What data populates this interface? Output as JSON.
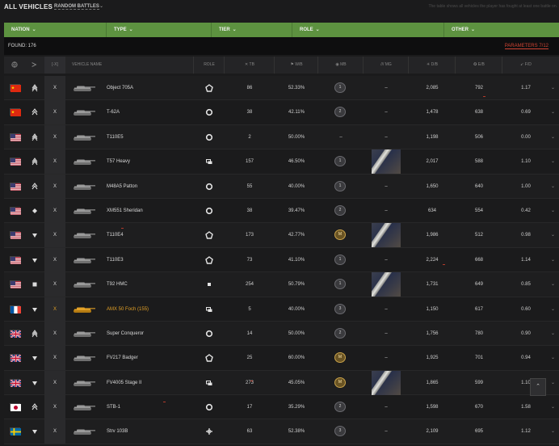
{
  "header": {
    "title": "ALL VEHICLES",
    "battle_mode": "RANDOM BATTLES",
    "note": "The table shows all vehicles the player has fought at least one battle on."
  },
  "filters": [
    {
      "label": "NATION"
    },
    {
      "label": "TYPE"
    },
    {
      "label": "TIER"
    },
    {
      "label": "ROLE"
    },
    {
      "label": "OTHER"
    }
  ],
  "found_label": "FOUND: 176",
  "parameters_label": "PARAMETERS 7/12",
  "columns": {
    "tier": "[-X]",
    "vehicle_name": "VEHICLE NAME",
    "role": "ROLE",
    "battles": "TB",
    "winrate": "W/B",
    "mastery": "MB",
    "marks": "MG",
    "damage": "D/B",
    "exp": "E/B",
    "frags": "F/D"
  },
  "colors": {
    "accent_green": "#5d9240",
    "params_red": "#cf4433",
    "highlight_orange": "#e3a126"
  },
  "rows": [
    {
      "flag": "china",
      "type_icon": "heavy-tank-icon",
      "tier": "X",
      "name": "Object 705A",
      "role_icon": "role-break-through-icon",
      "battles": "86",
      "winrate": "52.33%",
      "mastery": "1",
      "mastery_gold": false,
      "marks": "–",
      "has_marks": false,
      "dmg": "2,085",
      "exp": "792",
      "frags": "1.17"
    },
    {
      "flag": "china",
      "type_icon": "medium-tank-icon",
      "tier": "X",
      "name": "T-62A",
      "role_icon": "role-universal-icon",
      "battles": "38",
      "winrate": "42.11%",
      "mastery": "2",
      "mastery_gold": false,
      "marks": "–",
      "has_marks": false,
      "dmg": "1,478",
      "exp": "638",
      "frags": "0.69"
    },
    {
      "flag": "usa",
      "type_icon": "heavy-tank-icon",
      "tier": "X",
      "name": "T110E5",
      "role_icon": "role-universal-icon",
      "battles": "2",
      "winrate": "50.00%",
      "mastery": "–",
      "mastery_gold": false,
      "marks": "–",
      "has_marks": false,
      "dmg": "1,198",
      "exp": "506",
      "frags": "0.00"
    },
    {
      "flag": "usa",
      "type_icon": "heavy-tank-icon",
      "tier": "X",
      "name": "T57 Heavy",
      "role_icon": "role-support-icon",
      "battles": "157",
      "winrate": "46.50%",
      "mastery": "1",
      "mastery_gold": false,
      "marks": "",
      "has_marks": true,
      "dmg": "2,017",
      "exp": "588",
      "frags": "1.10"
    },
    {
      "flag": "usa",
      "type_icon": "medium-tank-icon",
      "tier": "X",
      "name": "M48A5 Patton",
      "role_icon": "role-universal-icon",
      "battles": "55",
      "winrate": "40.00%",
      "mastery": "1",
      "mastery_gold": false,
      "marks": "–",
      "has_marks": false,
      "dmg": "1,650",
      "exp": "640",
      "frags": "1.00"
    },
    {
      "flag": "usa",
      "type_icon": "light-tank-icon",
      "tier": "X",
      "name": "XM551 Sheridan",
      "role_icon": "role-universal-icon",
      "battles": "38",
      "winrate": "39.47%",
      "mastery": "2",
      "mastery_gold": false,
      "marks": "–",
      "has_marks": false,
      "dmg": "634",
      "exp": "554",
      "frags": "0.42"
    },
    {
      "flag": "usa",
      "type_icon": "tank-destroyer-icon",
      "tier": "X",
      "name": "T110E4",
      "role_icon": "role-break-through-icon",
      "battles": "173",
      "winrate": "42.77%",
      "mastery": "M",
      "mastery_gold": true,
      "marks": "",
      "has_marks": true,
      "dmg": "1,986",
      "exp": "512",
      "frags": "0.98"
    },
    {
      "flag": "usa",
      "type_icon": "tank-destroyer-icon",
      "tier": "X",
      "name": "T110E3",
      "role_icon": "role-break-through-icon",
      "battles": "73",
      "winrate": "41.10%",
      "mastery": "1",
      "mastery_gold": false,
      "marks": "–",
      "has_marks": false,
      "dmg": "2,224",
      "exp": "668",
      "frags": "1.14"
    },
    {
      "flag": "usa",
      "type_icon": "spg-icon",
      "tier": "X",
      "name": "T92 HMC",
      "role_icon": "role-spg-icon",
      "battles": "254",
      "winrate": "50.79%",
      "mastery": "1",
      "mastery_gold": false,
      "marks": "",
      "has_marks": true,
      "dmg": "1,731",
      "exp": "649",
      "frags": "0.85"
    },
    {
      "flag": "france",
      "type_icon": "tank-destroyer-icon",
      "tier": "X",
      "name": "AMX 50 Foch (155)",
      "role_icon": "role-support-icon",
      "battles": "5",
      "winrate": "40.00%",
      "mastery": "3",
      "mastery_gold": false,
      "marks": "–",
      "has_marks": false,
      "dmg": "1,150",
      "exp": "617",
      "frags": "0.60",
      "highlight": true
    },
    {
      "flag": "uk",
      "type_icon": "heavy-tank-icon",
      "tier": "X",
      "name": "Super Conqueror",
      "role_icon": "role-universal-icon",
      "battles": "14",
      "winrate": "50.00%",
      "mastery": "2",
      "mastery_gold": false,
      "marks": "–",
      "has_marks": false,
      "dmg": "1,756",
      "exp": "780",
      "frags": "0.90"
    },
    {
      "flag": "uk",
      "type_icon": "tank-destroyer-icon",
      "tier": "X",
      "name": "FV217 Badger",
      "role_icon": "role-break-through-icon",
      "battles": "25",
      "winrate": "60.00%",
      "mastery": "M",
      "mastery_gold": true,
      "marks": "–",
      "has_marks": false,
      "dmg": "1,925",
      "exp": "701",
      "frags": "0.94"
    },
    {
      "flag": "uk",
      "type_icon": "tank-destroyer-icon",
      "tier": "X",
      "name": "FV4005 Stage II",
      "role_icon": "role-support-icon",
      "battles": "273",
      "winrate": "45.05%",
      "mastery": "M",
      "mastery_gold": true,
      "marks": "",
      "has_marks": true,
      "dmg": "1,865",
      "exp": "599",
      "frags": "1.10"
    },
    {
      "flag": "japan",
      "type_icon": "medium-tank-icon",
      "tier": "X",
      "name": "STB-1",
      "role_icon": "role-universal-icon",
      "battles": "17",
      "winrate": "35.29%",
      "mastery": "2",
      "mastery_gold": false,
      "marks": "–",
      "has_marks": false,
      "dmg": "1,598",
      "exp": "670",
      "frags": "1.58"
    },
    {
      "flag": "sweden",
      "type_icon": "tank-destroyer-icon",
      "tier": "X",
      "name": "Strv 103B",
      "role_icon": "role-sniper-icon",
      "battles": "63",
      "winrate": "52.38%",
      "mastery": "3",
      "mastery_gold": false,
      "marks": "–",
      "has_marks": false,
      "dmg": "2,109",
      "exp": "695",
      "frags": "1.12"
    }
  ]
}
